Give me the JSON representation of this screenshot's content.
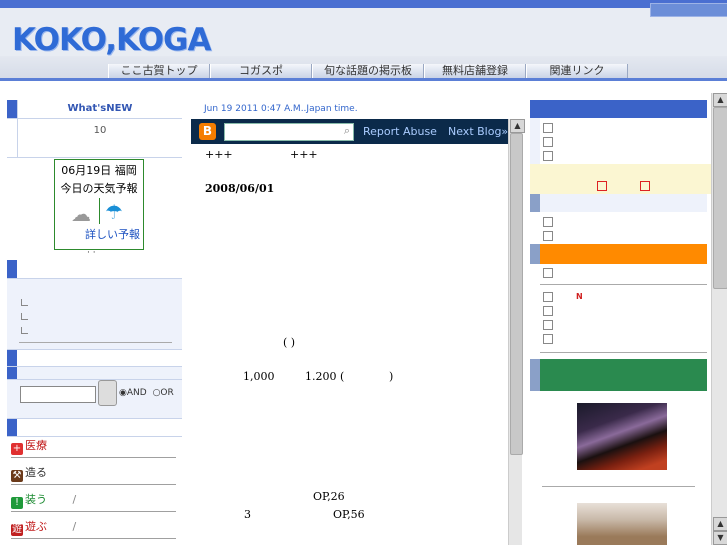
{
  "header": {
    "logo": "KOKO,KOGA",
    "nav": [
      "ここ古賀トップ",
      "コガスポ",
      "旬な話題の掲示板",
      "無料店舗登録",
      "関連リンク"
    ]
  },
  "left": {
    "whatsnew_title": "What'sNEW",
    "whatsnew_count": "10",
    "weather": {
      "date": "06月19日 福岡",
      "title": "今日の天気予報",
      "link": "詳しい予報"
    },
    "weather_dots": "· ·",
    "search": {
      "value": "",
      "button": "",
      "and": "AND",
      "or": "OR"
    },
    "menu": [
      {
        "label": "医療",
        "icon": "plus-icon",
        "color": "#e03030"
      },
      {
        "label": "造る",
        "icon": "hammer-icon",
        "color": "#6b3a1a"
      },
      {
        "label": "装う",
        "icon": "shirt-icon",
        "color": "#1f9a3a",
        "extra": "/"
      },
      {
        "label": "遊ぶ",
        "icon": "play-icon",
        "color": "#c02020",
        "extra": "/"
      }
    ]
  },
  "center": {
    "date": "Jun 19 2011 0:47 A.M..Japan time.",
    "report": "Report Abuse",
    "next": "Next Blog»",
    "plus_left": "+++",
    "plus_right": "+++",
    "post_date": "2008/06/01",
    "paren": "( )",
    "line_a": "1,000",
    "line_b": "1.200 (",
    "line_c": ")",
    "op26": "OP,26",
    "three": "3",
    "op56": "OP,56"
  },
  "right": {
    "n_label": "N"
  }
}
